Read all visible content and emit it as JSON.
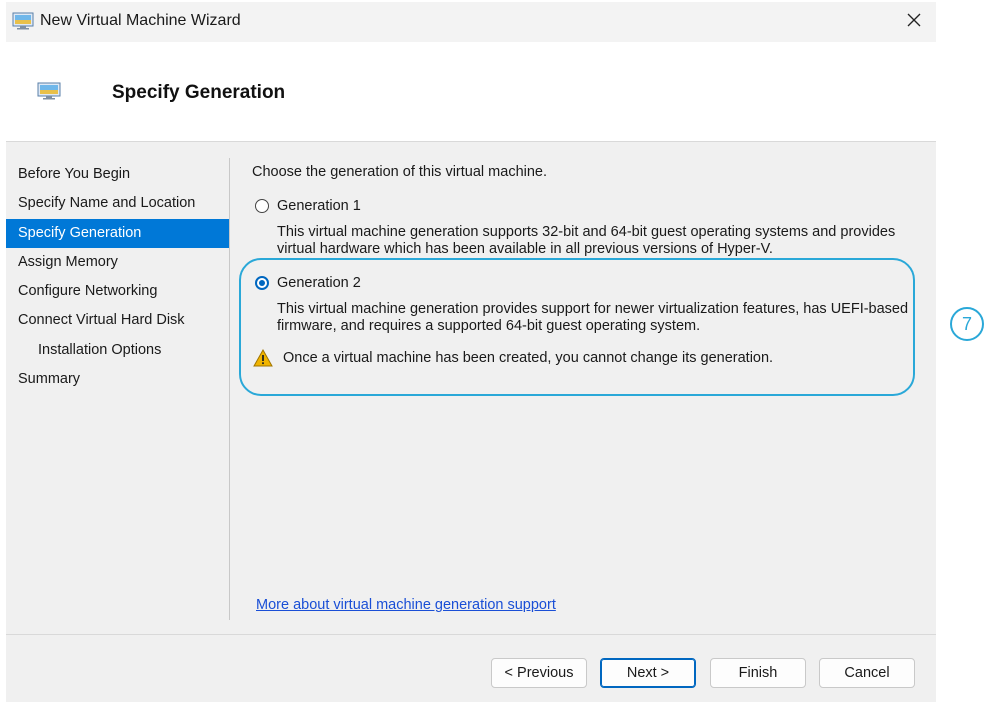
{
  "window": {
    "title": "New Virtual Machine Wizard"
  },
  "header": {
    "title": "Specify Generation"
  },
  "sidebar": {
    "items": [
      {
        "label": "Before You Begin"
      },
      {
        "label": "Specify Name and Location"
      },
      {
        "label": "Specify Generation"
      },
      {
        "label": "Assign Memory"
      },
      {
        "label": "Configure Networking"
      },
      {
        "label": "Connect Virtual Hard Disk"
      },
      {
        "label": "Installation Options"
      },
      {
        "label": "Summary"
      }
    ],
    "selected": "Specify Generation"
  },
  "main": {
    "prompt": "Choose the generation of this virtual machine.",
    "gen1": {
      "label": "Generation 1",
      "desc_line1": "This virtual machine generation supports 32-bit and 64-bit guest operating systems and provides",
      "desc_line2": "virtual hardware which has been available in all previous versions of Hyper-V.",
      "selected": false
    },
    "gen2": {
      "label": "Generation 2",
      "desc_line1": "This virtual machine generation provides support for newer virtualization features, has UEFI-based",
      "desc_line2": "firmware, and requires a supported 64-bit guest operating system.",
      "selected": true
    },
    "warning": "Once a virtual machine has been created, you cannot change its generation.",
    "help_link": "More about virtual machine generation support"
  },
  "buttons": {
    "previous": "< Previous",
    "next": "Next >",
    "finish": "Finish",
    "cancel": "Cancel"
  },
  "callout": {
    "number": "7"
  },
  "icons": {
    "window": "vm-monitor-icon",
    "close": "close-icon",
    "header": "vm-monitor-icon",
    "warning": "warning-icon"
  },
  "colors": {
    "selection": "#0078d7",
    "highlight": "#2aa8d8",
    "link": "#1a4fd6",
    "warning": "#f0b400"
  }
}
